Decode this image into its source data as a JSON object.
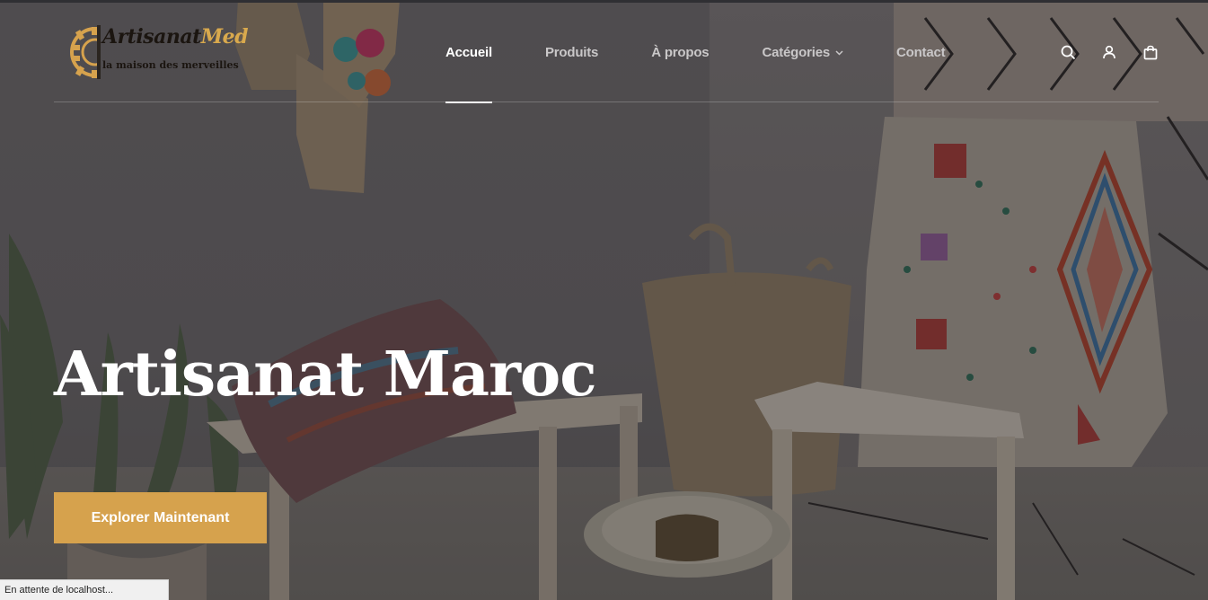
{
  "brand": {
    "name_main": "Artisanat",
    "name_accent": "Med",
    "tagline": "la maison des merveilles",
    "accent_color": "#d6a24d"
  },
  "nav": {
    "items": [
      {
        "label": "Accueil",
        "active": true
      },
      {
        "label": "Produits",
        "active": false
      },
      {
        "label": "À propos",
        "active": false
      },
      {
        "label": "Catégories",
        "active": false,
        "has_dropdown": true
      },
      {
        "label": "Contact",
        "active": false
      }
    ]
  },
  "tools": {
    "icons": [
      "search-icon",
      "user-icon",
      "shopping-bag-icon"
    ]
  },
  "hero": {
    "title": "Artisanat Maroc",
    "cta_label": "Explorer Maintenant"
  },
  "status_bar": {
    "text": "En attente de localhost..."
  }
}
